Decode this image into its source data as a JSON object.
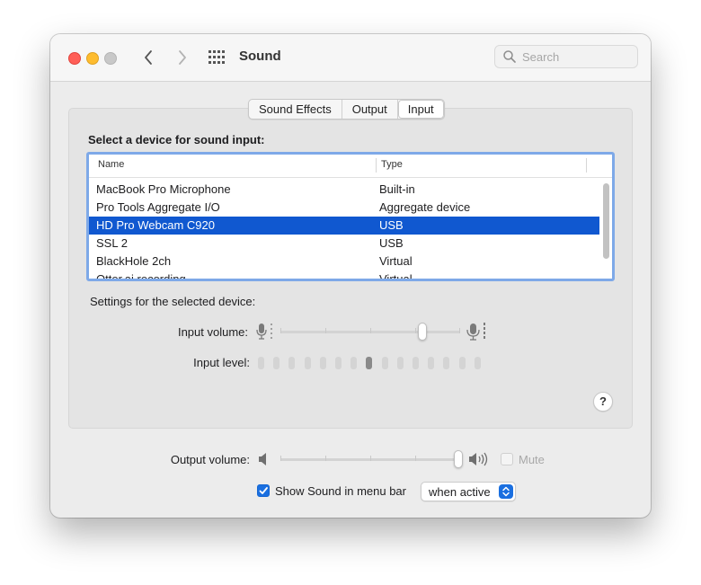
{
  "window": {
    "title": "Sound",
    "search_placeholder": "Search"
  },
  "tabs": [
    {
      "label": "Sound Effects",
      "active": false
    },
    {
      "label": "Output",
      "active": false
    },
    {
      "label": "Input",
      "active": true
    }
  ],
  "input": {
    "section_title": "Select a device for sound input:",
    "columns": {
      "name": "Name",
      "type": "Type"
    },
    "devices": [
      {
        "name": "MacBook Pro Microphone",
        "type": "Built-in"
      },
      {
        "name": "Pro Tools Aggregate I/O",
        "type": "Aggregate device"
      },
      {
        "name": "HD Pro Webcam C920",
        "type": "USB",
        "selected": true
      },
      {
        "name": "SSL 2",
        "type": "USB"
      },
      {
        "name": "BlackHole 2ch",
        "type": "Virtual"
      },
      {
        "name": "Otter.ai recording",
        "type": "Virtual"
      }
    ],
    "settings_label": "Settings for the selected device:",
    "input_volume_label": "Input volume:",
    "input_volume": 0.79,
    "input_level_label": "Input level:",
    "input_level_segments": 15,
    "input_level_active_index": 7
  },
  "footer": {
    "output_volume_label": "Output volume:",
    "output_volume": 0.99,
    "mute_label": "Mute",
    "mute_checked": false,
    "menubar_label": "Show Sound in menu bar",
    "menubar_checked": true,
    "menubar_option": "when active"
  },
  "colors": {
    "accent": "#1a6fe0",
    "selection": "#1058d0",
    "focus_ring": "#7ea9e8"
  },
  "icons": [
    "close-light",
    "minimize-light",
    "zoom-light",
    "chevron-left-icon",
    "chevron-right-icon",
    "grid-icon",
    "search-icon",
    "microphone-icon",
    "speaker-icon",
    "help-icon"
  ]
}
